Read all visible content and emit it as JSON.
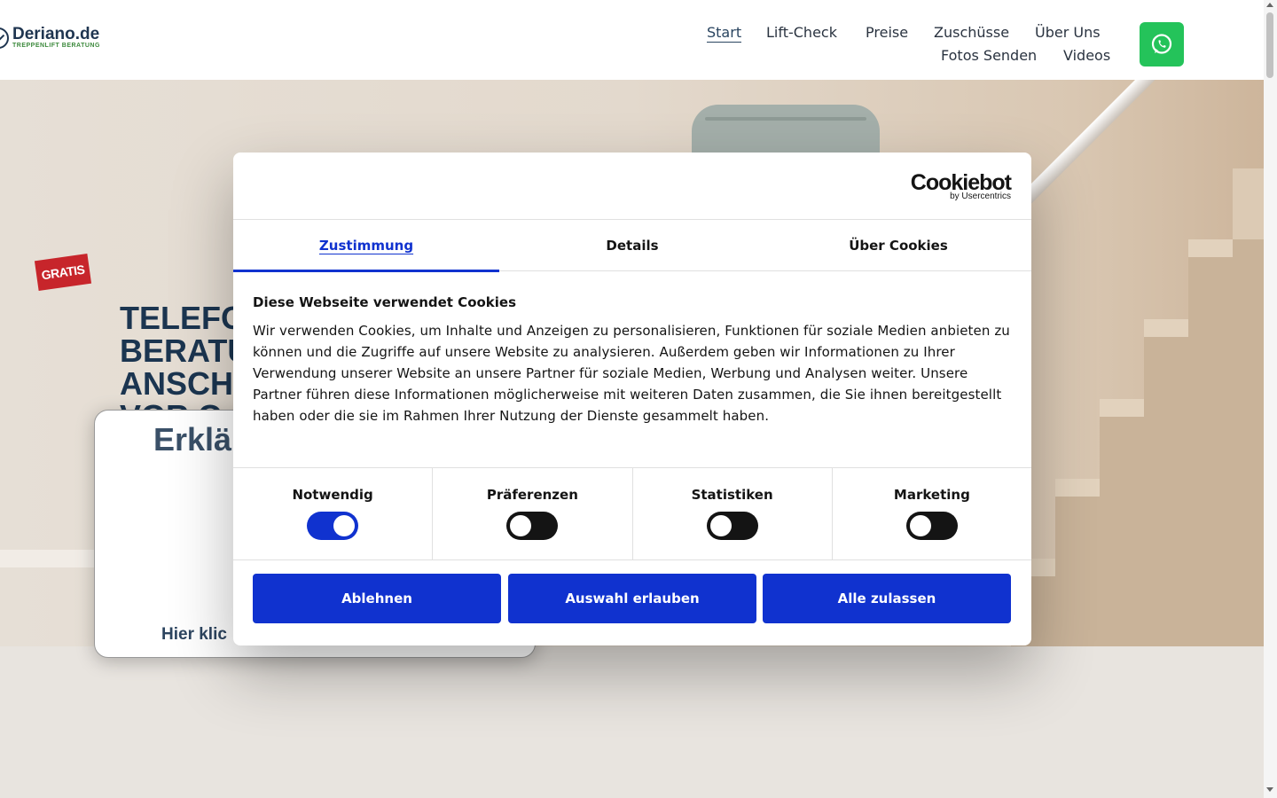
{
  "header": {
    "logo_name": "Deriano.de",
    "logo_sub": "TREPPENLIFT BERATUNG",
    "nav": [
      "Start",
      "Lift-Check",
      "Preise",
      "Zuschüsse",
      "Über Uns",
      "Fotos Senden",
      "Videos"
    ]
  },
  "hero": {
    "badge": "GRATIS",
    "title": "TELEFO\nBERATU\nANSCH\nVOR O",
    "card_title": "Erklä",
    "card_cta": "Hier klic"
  },
  "dialog": {
    "brand": "Cookiebot",
    "brand_sub": "by Usercentrics",
    "tabs": [
      "Zustimmung",
      "Details",
      "Über Cookies"
    ],
    "heading": "Diese Webseite verwendet Cookies",
    "text": "Wir verwenden Cookies, um Inhalte und Anzeigen zu personalisieren, Funktionen für soziale Medien anbieten zu können und die Zugriffe auf unsere Website zu analysieren. Außerdem geben wir Informationen zu Ihrer Verwendung unserer Website an unsere Partner für soziale Medien, Werbung und Analysen weiter. Unsere Partner führen diese Informationen möglicherweise mit weiteren Daten zusammen, die Sie ihnen bereitgestellt haben oder die sie im Rahmen Ihrer Nutzung der Dienste gesammelt haben.",
    "categories": [
      {
        "label": "Notwendig",
        "on": true
      },
      {
        "label": "Präferenzen",
        "on": false
      },
      {
        "label": "Statistiken",
        "on": false
      },
      {
        "label": "Marketing",
        "on": false
      }
    ],
    "buttons": [
      "Ablehnen",
      "Auswahl erlauben",
      "Alle zulassen"
    ]
  },
  "colors": {
    "accent": "#1032cf",
    "brand_dark": "#1f3550",
    "whatsapp": "#24c35a",
    "badge_red": "#c7252b"
  }
}
